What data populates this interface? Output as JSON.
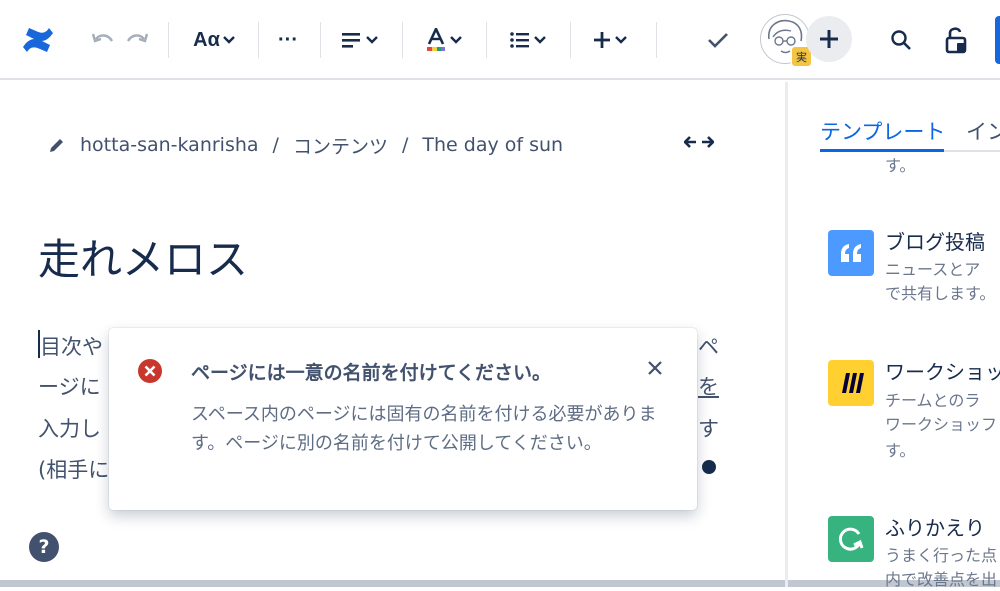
{
  "toolbar": {
    "text_style_label": "Aα",
    "more_label": "···"
  },
  "avatar": {
    "badge": "実"
  },
  "breadcrumb": {
    "items": [
      "hotta-san-kanrisha",
      "コンテンツ",
      "The day of sun"
    ],
    "separator": "/"
  },
  "page": {
    "title": "走れメロス",
    "body_lines": [
      "目次や",
      "ージに",
      "入力し",
      "(相手に"
    ],
    "right_fragments": [
      "ペ",
      "を",
      "す"
    ]
  },
  "flag": {
    "title": "ページには一意の名前を付けてください。",
    "description": "スペース内のページには固有の名前を付ける必要があります。ページに別の名前を付けて公開してください。"
  },
  "panel": {
    "tabs": [
      {
        "label": "テンプレート",
        "active": true
      },
      {
        "label": "イン",
        "active": false
      }
    ],
    "top_fragment": "す。",
    "templates": [
      {
        "name": "ブログ投稿",
        "desc": [
          "ニュースとア",
          "で共有します。"
        ],
        "icon": "quote-icon",
        "color": "#4C9AFF"
      },
      {
        "name": "ワークショッ",
        "desc": [
          "チームとのラ",
          "ワークショッフ",
          "す。"
        ],
        "icon": "miro-icon",
        "color": "#FFD02F"
      },
      {
        "name": "ふりかえり",
        "desc": [
          "うまく行った点",
          "内で改善点を出"
        ],
        "icon": "retro-icon",
        "color": "#36B37E"
      }
    ]
  },
  "colors": {
    "accent": "#0C66E4",
    "error": "#C9372C",
    "text": "#172B4D"
  }
}
